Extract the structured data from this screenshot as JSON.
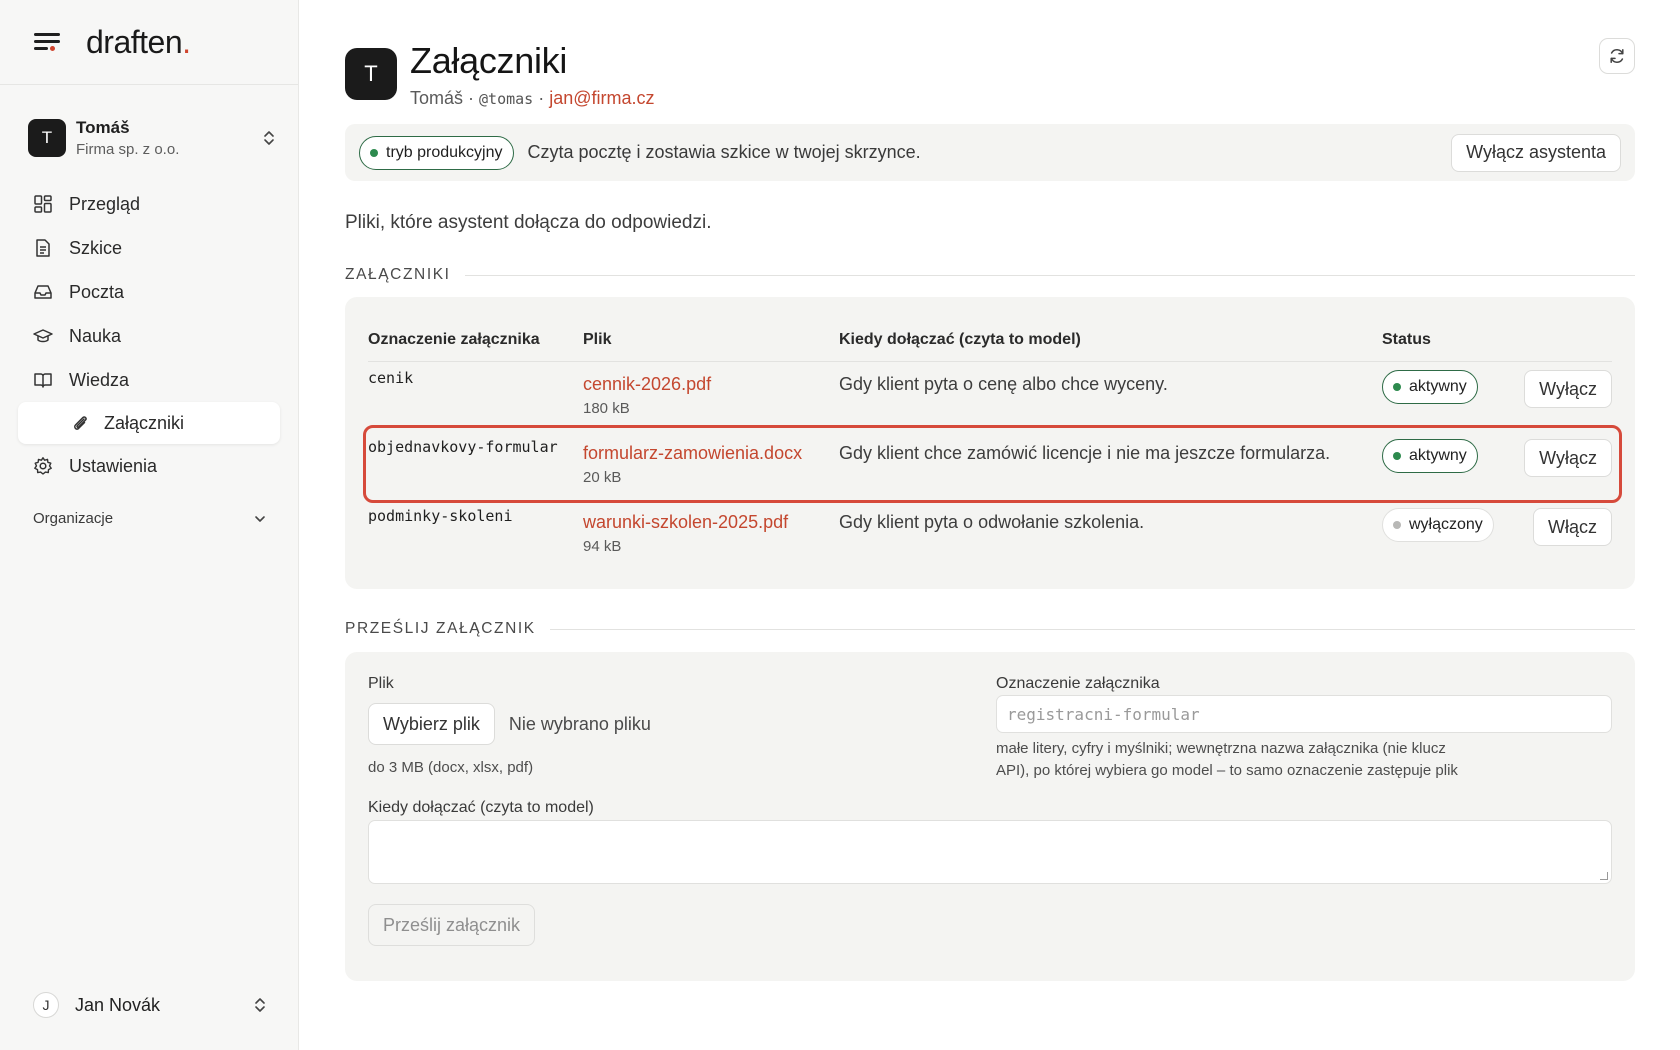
{
  "app": {
    "logo": "draften",
    "logo_dot": "."
  },
  "workspace": {
    "avatar": "T",
    "name": "Tomáš",
    "company": "Firma sp. z o.o."
  },
  "nav": {
    "items": [
      {
        "label": "Przegląd",
        "icon": "dashboard-icon"
      },
      {
        "label": "Szkice",
        "icon": "document-icon"
      },
      {
        "label": "Poczta",
        "icon": "inbox-icon"
      },
      {
        "label": "Nauka",
        "icon": "graduation-cap-icon"
      },
      {
        "label": "Wiedza",
        "icon": "book-icon"
      }
    ],
    "sub_item": {
      "label": "Załączniki",
      "icon": "paperclip-icon"
    },
    "settings": {
      "label": "Ustawienia",
      "icon": "gear-icon"
    },
    "org_label": "Organizacje"
  },
  "user": {
    "avatar": "J",
    "name": "Jan Novák"
  },
  "header": {
    "avatar": "T",
    "title": "Załączniki",
    "name": "Tomáš",
    "sep": " · ",
    "handle": "@tomas",
    "email": "jan@firma.cz"
  },
  "banner": {
    "mode": "tryb produkcyjny",
    "text": "Czyta pocztę i zostawia szkice w twojej skrzynce.",
    "button": "Wyłącz asystenta"
  },
  "intro": "Pliki, które asystent dołącza do odpowiedzi.",
  "attachments": {
    "section": "ZAŁĄCZNIKI",
    "columns": [
      "Oznaczenie załącznika",
      "Plik",
      "Kiedy dołączać (czyta to model)",
      "Status"
    ],
    "rows": [
      {
        "label": "cenik",
        "file": "cennik-2026.pdf",
        "size": "180 kB",
        "when": "Gdy klient pyta o cenę albo chce wyceny.",
        "status": "aktywny",
        "action": "Wyłącz"
      },
      {
        "label": "objednavkovy-formular",
        "file": "formularz-zamowienia.docx",
        "size": "20 kB",
        "when": "Gdy klient chce zamówić licencje i nie ma jeszcze formularza.",
        "status": "aktywny",
        "action": "Wyłącz"
      },
      {
        "label": "podminky-skoleni",
        "file": "warunki-szkolen-2025.pdf",
        "size": "94 kB",
        "when": "Gdy klient pyta o odwołanie szkolenia.",
        "status": "wyłączony",
        "action": "Włącz"
      }
    ]
  },
  "upload": {
    "section": "PRZEŚLIJ ZAŁĄCZNIK",
    "file_label": "Plik",
    "choose_button": "Wybierz plik",
    "no_file": "Nie wybrano pliku",
    "file_hint": "do 3 MB (docx, xlsx, pdf)",
    "tag_label": "Oznaczenie załącznika",
    "tag_placeholder": "registracni-formular",
    "tag_hint_1": "małe litery, cyfry i myślniki; wewnętrzna nazwa załącznika (nie klucz",
    "tag_hint_2": "API), po której wybiera go model – to samo oznaczenie zastępuje plik",
    "when_label": "Kiedy dołączać (czyta to model)",
    "submit": "Prześlij załącznik"
  },
  "colors": {
    "accent": "#c4472f",
    "active_green": "#2d8a4e",
    "highlight": "#d64a3b"
  }
}
